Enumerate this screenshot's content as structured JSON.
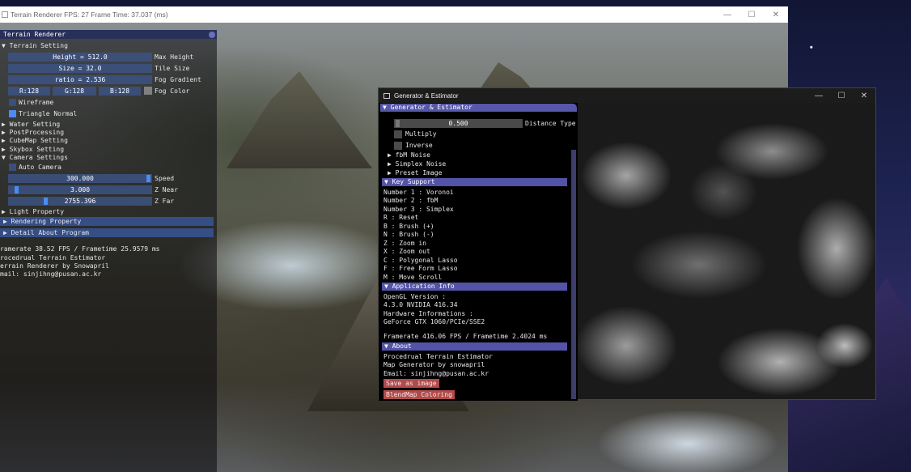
{
  "main_window": {
    "title": "Terrain Renderer   FPS: 27   Frame Time: 37.037 (ms)",
    "minimize": "—",
    "maximize": "☐",
    "close": "✕"
  },
  "terrain_panel": {
    "title": "Terrain Renderer",
    "terrain_setting": {
      "header": "▼ Terrain Setting",
      "height": {
        "value": "Height = 512.0",
        "label": "Max Height"
      },
      "size": {
        "value": "Size = 32.0",
        "label": "Tile Size"
      },
      "ratio": {
        "value": "ratio = 2.536",
        "label": "Fog Gradient"
      },
      "r": "R:128",
      "g": "G:128",
      "b": "B:128",
      "fog_color_label": "Fog Color",
      "wireframe": "Wireframe",
      "triangle_normal": "Triangle Normal"
    },
    "collapsed": [
      "▶ Water Setting",
      "▶ PostProcessing",
      "▶ CubeMap Setting",
      "▶ Skybox Setting"
    ],
    "camera": {
      "header": "▼ Camera Settings",
      "auto_camera": "Auto Camera",
      "speed": {
        "value": "300.000",
        "label": "Speed"
      },
      "znear": {
        "value": "3.000",
        "label": "Z Near"
      },
      "zfar": {
        "value": "2755.396",
        "label": "Z Far"
      }
    },
    "light_property": "▶ Light Property",
    "rendering_property": "▶ Rendering Property",
    "detail_about": "▶ Detail About Program",
    "info": [
      "ramerate 38.52 FPS / Frametime 25.9579 ms",
      "rocedrual Terrain Estimator",
      "errain Renderer by Snowapril",
      "mail: sinjihng@pusan.ac.kr"
    ]
  },
  "gen_window": {
    "title": "Generator & Estimator",
    "minimize": "—",
    "maximize": "☐",
    "close": "✕",
    "panel_title": "▼ Generator & Estimator",
    "slider_value": "0.500",
    "distance_type": "Distance Type",
    "multiply": "Multiply",
    "inverse": "Inverse",
    "fbm_noise": "▶ fbM Noise",
    "simplex_noise": "▶ Simplex Noise",
    "preset_image": "▶ Preset Image",
    "key_support_header": "▼  Key Support",
    "keys": [
      "Number 1 : Voronoi",
      "Number 2 : fbM",
      "Number 3 : Simplex",
      "R        : Reset",
      "B        : Brush (+)",
      "N        : Brush (-)",
      "Z        : Zoom in",
      "X        : Zoom out",
      "C        : Polygonal Lasso",
      "F        : Free Form Lasso",
      "M        : Move Scroll"
    ],
    "app_info_header": "▼  Application Info",
    "app_info": [
      "OpenGL Version :",
      "4.3.0 NVIDIA 416.34",
      "Hardware Informations :",
      "GeForce GTX 1060/PCIe/SSE2"
    ],
    "framerate": "Framerate 416.06 FPS / Frametime 2.4024 ms",
    "about_header": "▼  About",
    "about": [
      "Procedrual Terrain Estimator",
      "Map Generator by snowapril",
      "Email: sinjihng@pusan.ac.kr"
    ],
    "save_button": "Save as image",
    "blendmap_button": "BlendMap Coloring"
  }
}
